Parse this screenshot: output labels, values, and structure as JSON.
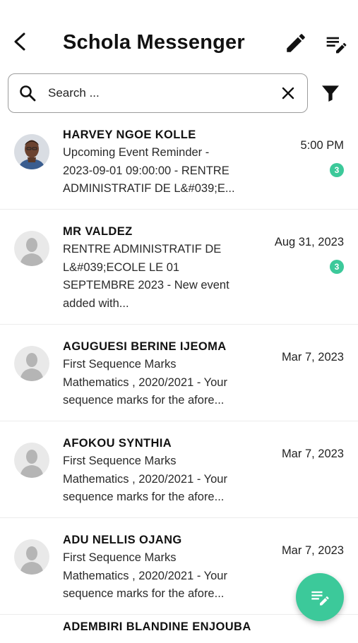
{
  "header": {
    "title": "Schola Messenger",
    "back_icon": "arrow-back-icon",
    "edit_icon": "pencil-icon",
    "compose_icon": "edit-list-icon"
  },
  "search": {
    "placeholder": "Search ...",
    "value": "",
    "clear_icon": "close-icon",
    "filter_icon": "filter-icon"
  },
  "messages": [
    {
      "sender": "HARVEY NGOE KOLLE",
      "preview": "Upcoming Event Reminder -\n2023-09-01 09:00:00 - RENTRE\nADMINISTRATIF DE L&#039;E...",
      "time": "5:00 PM",
      "unread": "3",
      "avatar": "photo"
    },
    {
      "sender": "MR VALDEZ",
      "preview": "RENTRE ADMINISTRATIF DE\nL&#039;ECOLE LE 01\nSEPTEMBRE 2023 - New event\nadded with...",
      "time": "Aug 31, 2023",
      "unread": "3",
      "avatar": "placeholder"
    },
    {
      "sender": "AGUGUESI BERINE IJEOMA",
      "preview": "First Sequence Marks\nMathematics , 2020/2021 - Your\nsequence marks for the afore...",
      "time": "Mar 7, 2023",
      "avatar": "placeholder"
    },
    {
      "sender": "AFOKOU SYNTHIA",
      "preview": "First Sequence Marks\nMathematics , 2020/2021 - Your\nsequence marks for the afore...",
      "time": "Mar 7, 2023",
      "avatar": "placeholder"
    },
    {
      "sender": "ADU NELLIS OJANG",
      "preview": "First Sequence Marks\nMathematics , 2020/2021 - Your\nsequence marks for the afore...",
      "time": "Mar 7, 2023",
      "avatar": "placeholder"
    },
    {
      "sender": "ADEMBIRI BLANDINE ENJOUBA",
      "avatar": "placeholder"
    }
  ],
  "fab": {
    "icon": "edit-list-icon"
  },
  "colors": {
    "accent": "#3cc99a",
    "text": "#111111",
    "border": "#9c9c9c"
  }
}
